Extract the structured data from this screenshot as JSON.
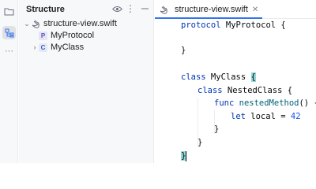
{
  "structure_panel": {
    "title": "Structure",
    "tree": [
      {
        "label": "structure-view.swift",
        "type": "file",
        "expanded": true
      },
      {
        "label": "MyProtocol",
        "type": "protocol",
        "badge": "P"
      },
      {
        "label": "MyClass",
        "type": "class",
        "badge": "C",
        "collapsed": true
      }
    ]
  },
  "editor": {
    "tab_label": "structure-view.swift",
    "code": {
      "l1": {
        "kw": "protocol",
        "name": " MyProtocol {"
      },
      "l3": "}",
      "l5": {
        "kw": "class",
        "name": " MyClass ",
        "brace": "{"
      },
      "l6": {
        "kw": "class",
        "name": " NestedClass {"
      },
      "l7": {
        "kw": "func",
        "fn": " nestedMethod",
        "rest": "() {"
      },
      "l8": {
        "kw": "let",
        "name": " local = ",
        "num": "42"
      },
      "l9": "}",
      "l10": "}",
      "l11": "}"
    }
  },
  "colors": {
    "accent": "#3574f0",
    "keyword": "#0033b3",
    "function": "#00627a",
    "number": "#1750eb",
    "brace_highlight": "#93d9d9"
  }
}
